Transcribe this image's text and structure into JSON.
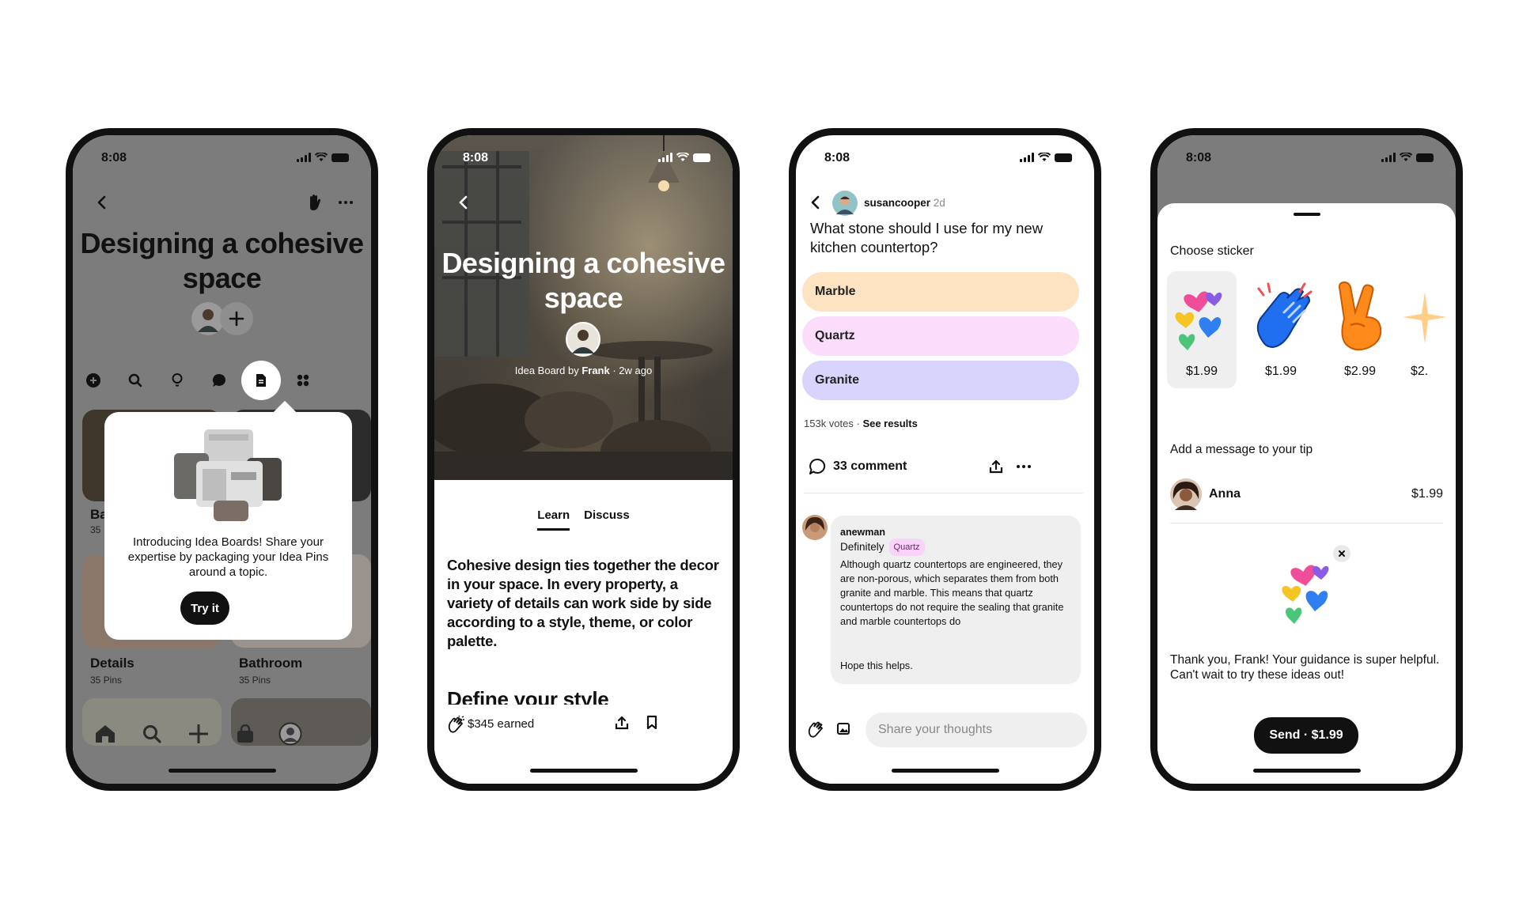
{
  "status": {
    "time": "8:08"
  },
  "phone1": {
    "title": "Designing a cohesive space",
    "popup": {
      "text": "Introducing Idea Boards! Share your expertise by packaging your Idea Pins around a topic.",
      "button": "Try it"
    },
    "partial_tile": {
      "label": "Ba",
      "sub": "35"
    },
    "tiles": [
      {
        "label": "Details",
        "sub": "35 Pins"
      },
      {
        "label": "Bathroom",
        "sub": "35 Pins"
      }
    ],
    "icons": {
      "back": "chevron-left-icon",
      "wave": "hand-wave-icon",
      "more": "more-icon",
      "tabs": [
        "plus-circle-icon",
        "search-icon",
        "lightbulb-icon",
        "speech-bubble-icon",
        "document-icon",
        "grid-icon"
      ],
      "nav": [
        "home-icon",
        "search-icon",
        "plus-icon",
        "shopping-bag-icon",
        "profile-icon"
      ]
    }
  },
  "phone2": {
    "title": "Designing a cohesive space",
    "byline_prefix": "Idea Board by ",
    "byline_author": "Frank",
    "byline_suffix": " · 2w ago",
    "tabs": [
      "Learn",
      "Discuss"
    ],
    "active_tab": "Learn",
    "body": "Cohesive design ties together the decor in your space. In every property, a variety of details can work side by side according to a style, theme, or color palette.",
    "heading": "Define your style",
    "earned": "$345 earned"
  },
  "phone3": {
    "author": "susancooper",
    "time_ago": "2d",
    "question": "What stone should I use for my new kitchen countertop?",
    "options": [
      {
        "label": "Marble",
        "color": "#fde3c2"
      },
      {
        "label": "Quartz",
        "color": "#fbdcfb"
      },
      {
        "label": "Granite",
        "color": "#d9d4fb"
      }
    ],
    "votes": "153k votes · ",
    "see_results": "See results",
    "comments_label": "33 comment",
    "comment": {
      "user": "anewman",
      "answer": "Definitely",
      "tag": "Quartz",
      "text": "Although quartz countertops are engineered, they are non-porous, which separates them from both granite and marble. This means that quartz countertops do not require the sealing that granite and marble countertops do",
      "closing": "Hope this helps."
    },
    "input_placeholder": "Share your thoughts"
  },
  "phone4": {
    "choose_label": "Choose sticker",
    "stickers": [
      {
        "price": "$1.99",
        "icon": "hearts-sticker-icon"
      },
      {
        "price": "$1.99",
        "icon": "clapping-hands-sticker-icon"
      },
      {
        "price": "$2.99",
        "icon": "peace-hand-sticker-icon"
      },
      {
        "price": "$2.",
        "icon": "sparkle-sticker-icon"
      }
    ],
    "message_label": "Add a message to your tip",
    "recipient": "Anna",
    "recipient_amount": "$1.99",
    "message": "Thank you, Frank! Your guidance is super helpful. Can't wait to try these ideas out!",
    "send_button": "Send · $1.99"
  }
}
